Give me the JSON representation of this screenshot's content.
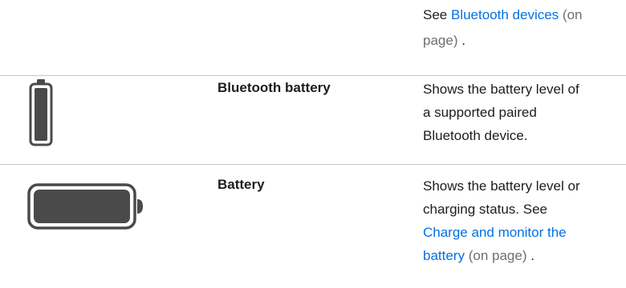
{
  "top_row": {
    "see": "See",
    "link": "Bluetooth devices",
    "suffix_paren": "(on",
    "suffix_line2": "page)",
    "period": "."
  },
  "rows": [
    {
      "icon": "bluetooth-battery-icon",
      "name": "Bluetooth battery",
      "desc_lines": [
        "Shows the battery level of",
        "a supported paired",
        "Bluetooth device."
      ]
    },
    {
      "icon": "battery-icon",
      "name": "Battery",
      "desc_line1": "Shows the battery level or",
      "desc_line2": "charging status. See",
      "link_line1": "Charge and monitor the",
      "link_line2": "battery",
      "suffix": "(on page)",
      "period": "."
    }
  ],
  "colors": {
    "link": "#0071e3",
    "icon_gray": "#4a4a4a",
    "divider": "#c7c7cc"
  }
}
